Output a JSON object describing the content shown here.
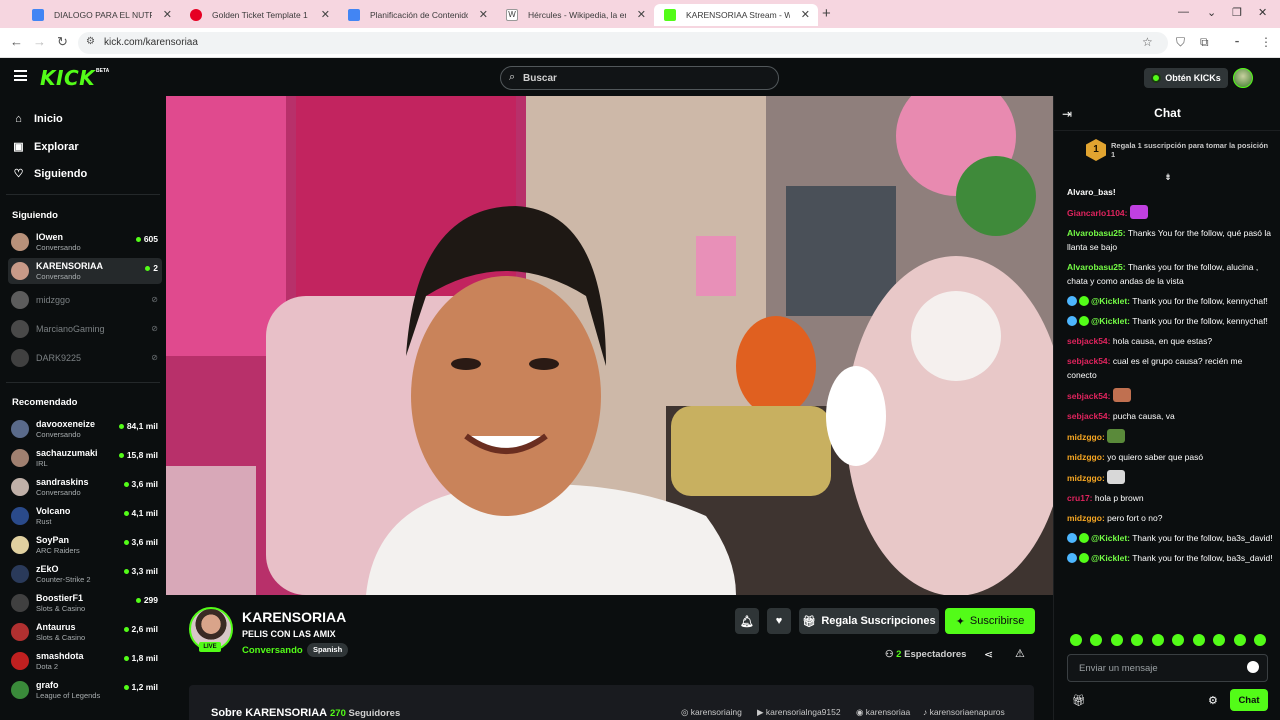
{
  "browser": {
    "tabs": [
      {
        "title": "DIALOGO PARA EL NUTRICION",
        "favicon": "docs-icon",
        "color": "#4285f4"
      },
      {
        "title": "Golden Ticket Template 1",
        "favicon": "pinterest-icon",
        "color": "#e60023"
      },
      {
        "title": "Planificación de Contenido - Di",
        "favicon": "docs-icon",
        "color": "#4285f4"
      },
      {
        "title": "Hércules - Wikipedia, la enciclo",
        "favicon": "wikipedia-icon",
        "color": "#ffffff"
      },
      {
        "title": "KARENSORIAA Stream - Watch",
        "favicon": "kick-icon",
        "color": "#53fc18"
      }
    ],
    "url": "kick.com/karensoriaa"
  },
  "topnav": {
    "logo": "KICK",
    "beta": "BETA",
    "search_placeholder": "Buscar",
    "get_kicks": "Obtén KICKs"
  },
  "sidebar": {
    "nav": [
      {
        "label": "Inicio",
        "icon": "home-icon"
      },
      {
        "label": "Explorar",
        "icon": "compass-icon"
      },
      {
        "label": "Siguiendo",
        "icon": "heart-icon"
      }
    ],
    "following_title": "Siguiendo",
    "following": [
      {
        "name": "lOwen",
        "category": "Conversando",
        "viewers": "605",
        "live": true,
        "color": "#b8917a"
      },
      {
        "name": "KARENSORIAA",
        "category": "Conversando",
        "viewers": "2",
        "live": true,
        "color": "#c89a88",
        "selected": true
      },
      {
        "name": "midzggo",
        "live": false,
        "color": "#9a9a9a"
      },
      {
        "name": "MarcianoGaming",
        "live": false,
        "color": "#7a7a7a"
      },
      {
        "name": "DARK9225",
        "live": false,
        "color": "#6a6a6a"
      }
    ],
    "recommended_title": "Recomendado",
    "recommended": [
      {
        "name": "davooxeneize",
        "category": "Conversando",
        "viewers": "84,1 mil",
        "color": "#5a6a8a"
      },
      {
        "name": "sachauzumaki",
        "category": "IRL",
        "viewers": "15,8 mil",
        "color": "#a08070"
      },
      {
        "name": "sandraskins",
        "category": "Conversando",
        "viewers": "3,6 mil",
        "color": "#c0b0a8"
      },
      {
        "name": "Volcano",
        "category": "Rust",
        "viewers": "4,1 mil",
        "color": "#2a4a8a"
      },
      {
        "name": "SoyPan",
        "category": "ARC Raiders",
        "viewers": "3,6 mil",
        "color": "#e0d0a0"
      },
      {
        "name": "zEkO",
        "category": "Counter-Strike 2",
        "viewers": "3,3 mil",
        "color": "#2a3a5a"
      },
      {
        "name": "BoostierF1",
        "category": "Slots & Casino",
        "viewers": "299",
        "color": "#404040"
      },
      {
        "name": "Antaurus",
        "category": "Slots & Casino",
        "viewers": "2,6 mil",
        "color": "#b03030"
      },
      {
        "name": "smashdota",
        "category": "Dota 2",
        "viewers": "1,8 mil",
        "color": "#c02020"
      },
      {
        "name": "grafo",
        "category": "League of Legends",
        "viewers": "1,2 mil",
        "color": "#3a8a3a"
      }
    ]
  },
  "stream": {
    "channel": "KARENSORIAA",
    "title": "PELIS CON LAS AMIX",
    "category": "Conversando",
    "language": "Spanish",
    "live_badge": "LIVE",
    "gift_label": "Regala Suscripciones",
    "subscribe_label": "Suscribirse",
    "viewers_count": "2",
    "viewers_label": "Espectadores",
    "about_title": "Sobre KARENSORIAA",
    "followers_count": "270",
    "followers_label": "Seguidores",
    "socials": [
      {
        "icon": "instagram-icon",
        "handle": "karensoriaing"
      },
      {
        "icon": "youtube-icon",
        "handle": "karensorialnga9152"
      },
      {
        "icon": "discord-icon",
        "handle": "karensoriaa"
      },
      {
        "icon": "tiktok-icon",
        "handle": "karensoriaenapuros"
      }
    ]
  },
  "chat": {
    "title": "Chat",
    "pinned_rank": "1",
    "pinned_text": "Regala 1 suscripción para tomar la posición 1",
    "messages": [
      {
        "user": "",
        "text": "Alvaro_bas!",
        "color": "#ffffff"
      },
      {
        "user": "Giancarlo1104:",
        "text": "",
        "color": "#e0245e",
        "emote": "#c040e0"
      },
      {
        "user": "Alvarobasu25:",
        "text": "Thanks You for the follow, qué pasó la llanta se bajo",
        "color": "#75fd46"
      },
      {
        "user": "Alvarobasu25:",
        "text": "Thanks you for the follow, alucina , chata y como andas de la vista",
        "color": "#75fd46"
      },
      {
        "user": "@Kicklet:",
        "text": "Thank you for the follow, kennychaf!",
        "color": "#75fd46",
        "bot": true
      },
      {
        "user": "@Kicklet:",
        "text": "Thank you for the follow, kennychaf!",
        "color": "#75fd46",
        "bot": true
      },
      {
        "user": "sebjack54:",
        "text": "hola causa, en que estas?",
        "color": "#e0245e"
      },
      {
        "user": "sebjack54:",
        "text": "cual es el grupo causa? recién me conecto",
        "color": "#e0245e"
      },
      {
        "user": "sebjack54:",
        "text": "",
        "color": "#e0245e",
        "emote": "#c07050"
      },
      {
        "user": "sebjack54:",
        "text": "pucha causa, va",
        "color": "#e0245e"
      },
      {
        "user": "midzggo:",
        "text": "",
        "color": "#f5a623",
        "emote": "#5a8a3a"
      },
      {
        "user": "midzggo:",
        "text": "yo quiero saber que pasó",
        "color": "#f5a623"
      },
      {
        "user": "midzggo:",
        "text": "",
        "color": "#f5a623",
        "emote": "#d8d8d8"
      },
      {
        "user": "cru17:",
        "text": "hola p brown",
        "color": "#e0245e"
      },
      {
        "user": "midzggo:",
        "text": "pero fort o no?",
        "color": "#f5a623"
      },
      {
        "user": "@Kicklet:",
        "text": "Thank you for the follow, ba3s_david!",
        "color": "#75fd46",
        "bot": true
      },
      {
        "user": "@Kicklet:",
        "text": "Thank you for the follow, ba3s_david!",
        "color": "#75fd46",
        "bot": true
      }
    ],
    "input_placeholder": "Enviar un mensaje",
    "send_label": "Chat"
  }
}
